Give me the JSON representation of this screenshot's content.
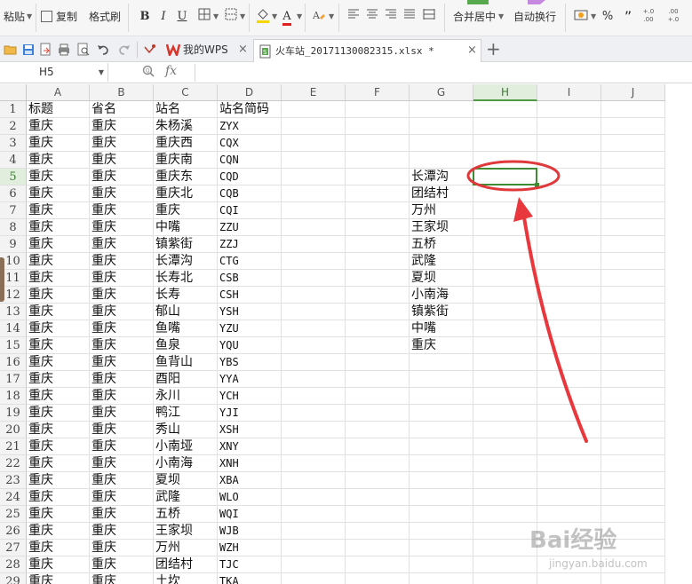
{
  "ribbon": {
    "paste_label": "粘贴",
    "copy_label": "复制",
    "format_painter_label": "格式刷",
    "bold_label": "B",
    "italic_label": "I",
    "underline_label": "U",
    "font_color_label": "A",
    "merge_center_label": "合并居中",
    "wrap_text_label": "自动换行",
    "percent_label": "%",
    "comma_label": "”",
    "inc_decimal_label": "+.0 .00",
    "dec_decimal_label": ".00 +.0"
  },
  "tabs": [
    {
      "label": "我的WPS",
      "icon": "wps-logo-icon",
      "active": false
    },
    {
      "label": "火车站_20171130082315.xlsx *",
      "icon": "spreadsheet-file-icon",
      "active": true
    }
  ],
  "new_tab_label": "+",
  "formula_bar": {
    "name_box": "H5",
    "zoom_icon": "magnifier-icon",
    "fx_label": "fx",
    "formula_value": ""
  },
  "sheet": {
    "columns": [
      "A",
      "B",
      "C",
      "D",
      "E",
      "F",
      "G",
      "H",
      "I",
      "J"
    ],
    "selected_column": "H",
    "selected_row": 5,
    "row_numbers": [
      1,
      2,
      3,
      4,
      5,
      6,
      7,
      8,
      9,
      10,
      11,
      12,
      13,
      14,
      15,
      16,
      17,
      18,
      19,
      20,
      21,
      22,
      23,
      24,
      25,
      26,
      27,
      28,
      29
    ],
    "rows": [
      [
        "标题",
        "省名",
        "站名",
        "站名简码"
      ],
      [
        "重庆",
        "重庆",
        "朱杨溪",
        "ZYX"
      ],
      [
        "重庆",
        "重庆",
        "重庆西",
        "CQX"
      ],
      [
        "重庆",
        "重庆",
        "重庆南",
        "CQN"
      ],
      [
        "重庆",
        "重庆",
        "重庆东",
        "CQD"
      ],
      [
        "重庆",
        "重庆",
        "重庆北",
        "CQB"
      ],
      [
        "重庆",
        "重庆",
        "重庆",
        "CQI"
      ],
      [
        "重庆",
        "重庆",
        "中嘴",
        "ZZU"
      ],
      [
        "重庆",
        "重庆",
        "镇紫街",
        "ZZJ"
      ],
      [
        "重庆",
        "重庆",
        "长潭沟",
        "CTG"
      ],
      [
        "重庆",
        "重庆",
        "长寿北",
        "CSB"
      ],
      [
        "重庆",
        "重庆",
        "长寿",
        "CSH"
      ],
      [
        "重庆",
        "重庆",
        "郁山",
        "YSH"
      ],
      [
        "重庆",
        "重庆",
        "鱼嘴",
        "YZU"
      ],
      [
        "重庆",
        "重庆",
        "鱼泉",
        "YQU"
      ],
      [
        "重庆",
        "重庆",
        "鱼背山",
        "YBS"
      ],
      [
        "重庆",
        "重庆",
        "酉阳",
        "YYA"
      ],
      [
        "重庆",
        "重庆",
        "永川",
        "YCH"
      ],
      [
        "重庆",
        "重庆",
        "鸭江",
        "YJI"
      ],
      [
        "重庆",
        "重庆",
        "秀山",
        "XSH"
      ],
      [
        "重庆",
        "重庆",
        "小南垭",
        "XNY"
      ],
      [
        "重庆",
        "重庆",
        "小南海",
        "XNH"
      ],
      [
        "重庆",
        "重庆",
        "夏坝",
        "XBA"
      ],
      [
        "重庆",
        "重庆",
        "武隆",
        "WLO"
      ],
      [
        "重庆",
        "重庆",
        "五桥",
        "WQI"
      ],
      [
        "重庆",
        "重庆",
        "王家坝",
        "WJB"
      ],
      [
        "重庆",
        "重庆",
        "万州",
        "WZH"
      ],
      [
        "重庆",
        "重庆",
        "团结村",
        "TJC"
      ],
      [
        "重庆",
        "重庆",
        "土坎",
        "TKA"
      ]
    ],
    "column_g": [
      {
        "row": 5,
        "value": "长潭沟"
      },
      {
        "row": 6,
        "value": "团结村"
      },
      {
        "row": 7,
        "value": "万州"
      },
      {
        "row": 8,
        "value": "王家坝"
      },
      {
        "row": 9,
        "value": "五桥"
      },
      {
        "row": 10,
        "value": "武隆"
      },
      {
        "row": 11,
        "value": "夏坝"
      },
      {
        "row": 12,
        "value": "小南海"
      },
      {
        "row": 13,
        "value": "镇紫街"
      },
      {
        "row": 14,
        "value": "中嘴"
      },
      {
        "row": 15,
        "value": "重庆"
      }
    ]
  },
  "annotation": {
    "ellipse_color": "#e0393b",
    "arrow_color": "#e8383d"
  },
  "watermark": {
    "text": "Bai经验",
    "sub": "jingyan.baidu.com"
  },
  "colors": {
    "selection_green": "#3f8a34",
    "header_bg": "#f3f3f3",
    "tab_bar_bg": "#eef0f3"
  }
}
